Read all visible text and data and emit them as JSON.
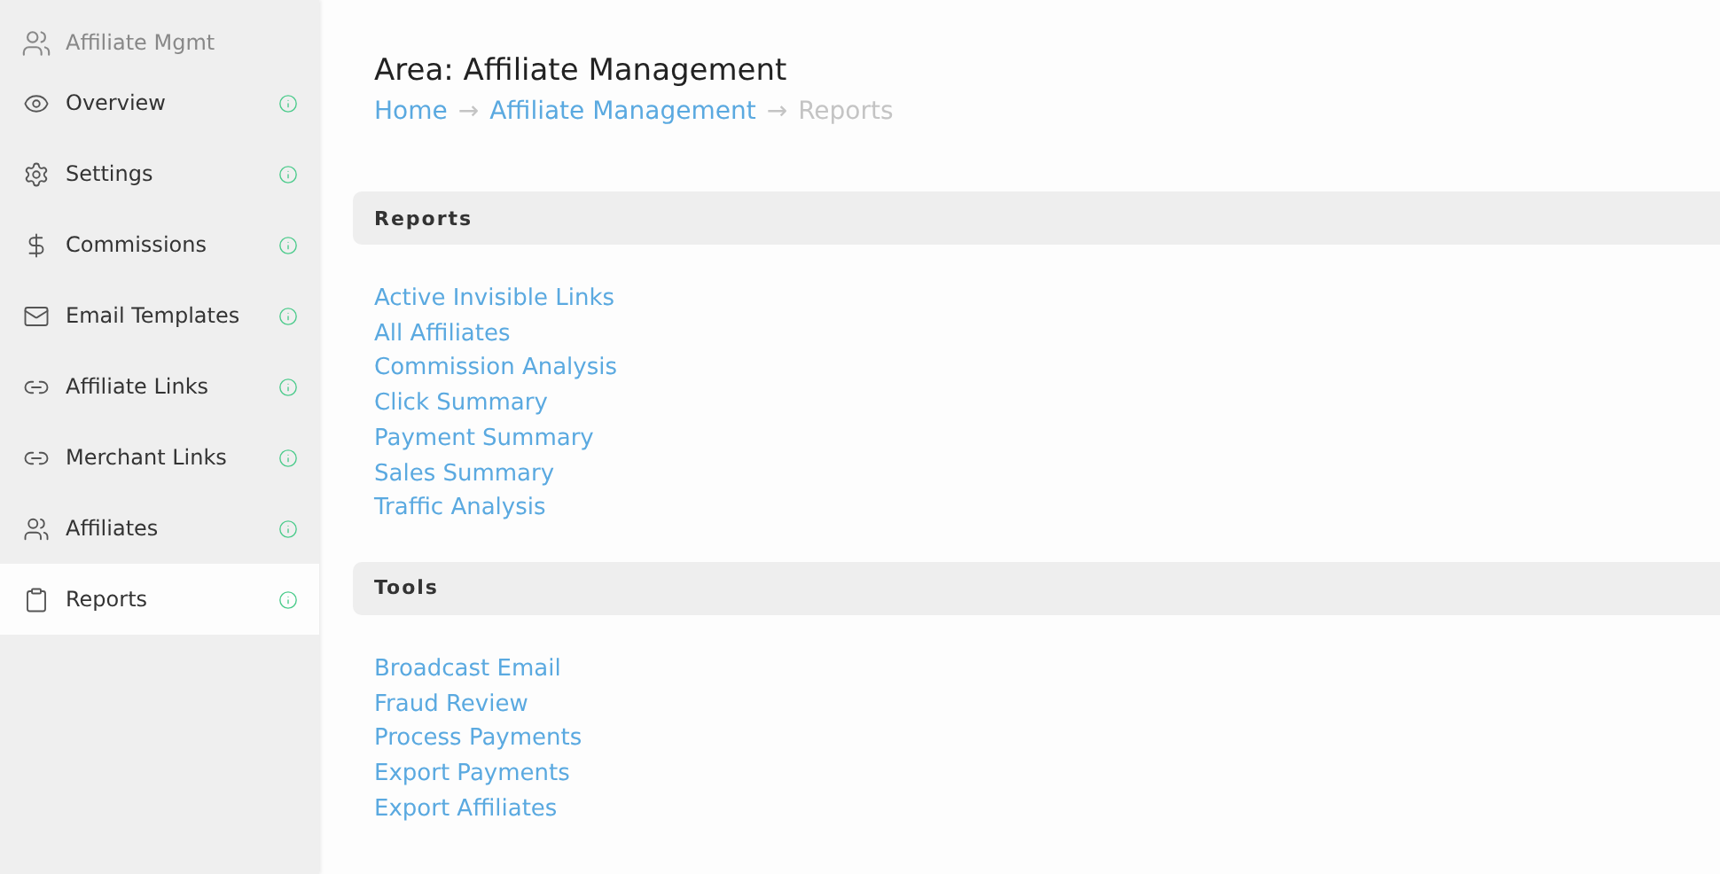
{
  "sidebar": {
    "header": "Affiliate Mgmt",
    "items": [
      {
        "label": "Overview",
        "kind": "eye",
        "selected": false
      },
      {
        "label": "Settings",
        "kind": "gear",
        "selected": false
      },
      {
        "label": "Commissions",
        "kind": "dollar",
        "selected": false
      },
      {
        "label": "Email Templates",
        "kind": "mail",
        "selected": false
      },
      {
        "label": "Affiliate Links",
        "kind": "link",
        "selected": false
      },
      {
        "label": "Merchant Links",
        "kind": "link",
        "selected": false
      },
      {
        "label": "Affiliates",
        "kind": "people",
        "selected": false
      },
      {
        "label": "Reports",
        "kind": "clipboard",
        "selected": true
      }
    ]
  },
  "page": {
    "title": "Area: Affiliate Management",
    "breadcrumb": [
      {
        "kind": "link",
        "text": "Home"
      },
      {
        "kind": "separator",
        "text": "→"
      },
      {
        "kind": "link",
        "text": "Affiliate Management"
      },
      {
        "kind": "separator",
        "text": "→"
      },
      {
        "kind": "current",
        "text": "Reports"
      }
    ],
    "sections": [
      {
        "title": "Reports",
        "links": [
          "Active Invisible Links",
          "All Affiliates",
          "Commission Analysis",
          "Click Summary",
          "Payment Summary",
          "Sales Summary",
          "Traffic Analysis"
        ]
      },
      {
        "title": "Tools",
        "links": [
          "Broadcast Email",
          "Fraud Review",
          "Process Payments",
          "Export Payments",
          "Export Affiliates"
        ]
      }
    ]
  }
}
